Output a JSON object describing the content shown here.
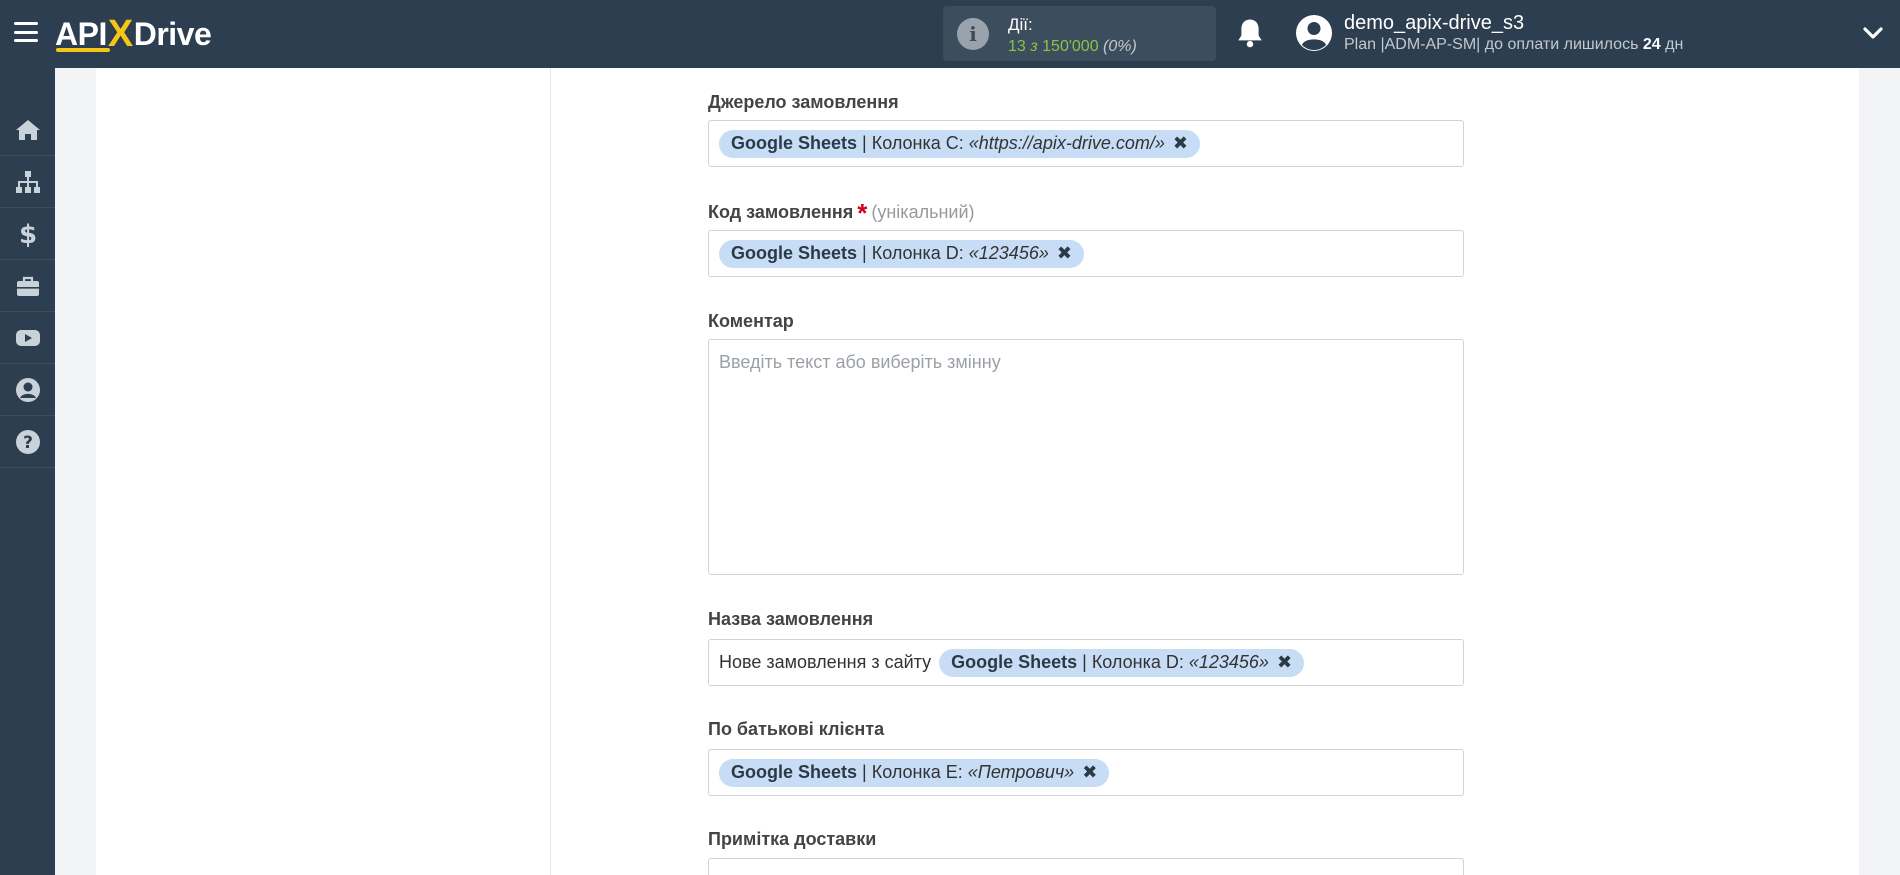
{
  "header": {
    "logo_left": "API",
    "logo_x": "X",
    "logo_right": "Drive",
    "actions_label": "Дії:",
    "actions_count": "13",
    "actions_of": "з",
    "actions_total": "150'000",
    "actions_pct": "(0%)",
    "username": "demo_apix-drive_s3",
    "plan_prefix": "Plan |ADM-AP-SM| до оплати лишилось",
    "plan_days": "24",
    "plan_suffix": "дн"
  },
  "sidebar": {
    "items": [
      {
        "icon": "home-icon"
      },
      {
        "icon": "sitemap-icon"
      },
      {
        "icon": "dollar-icon"
      },
      {
        "icon": "briefcase-icon"
      },
      {
        "icon": "youtube-icon"
      },
      {
        "icon": "user-circle-icon"
      },
      {
        "icon": "question-icon"
      }
    ]
  },
  "form": {
    "fields": [
      {
        "label": "Джерело замовлення",
        "chip": {
          "source": "Google Sheets",
          "separator": "|",
          "column": "Колонка C:",
          "value": "«https://apix-drive.com/»"
        }
      },
      {
        "label": "Код замовлення",
        "required": "*",
        "hint": "(унікальний)",
        "chip": {
          "source": "Google Sheets",
          "separator": "|",
          "column": "Колонка D:",
          "value": "«123456»"
        }
      },
      {
        "label": "Коментар",
        "placeholder": "Введіть текст або виберіть змінну"
      },
      {
        "label": "Назва замовлення",
        "prefix_text": "Нове замовлення з сайту",
        "chip": {
          "source": "Google Sheets",
          "separator": "|",
          "column": "Колонка D:",
          "value": "«123456»"
        }
      },
      {
        "label": "По батькові клієнта",
        "chip": {
          "source": "Google Sheets",
          "separator": "|",
          "column": "Колонка E:",
          "value": "«Петрович»"
        }
      },
      {
        "label": "Примітка доставки"
      }
    ],
    "remove_glyph": "✖"
  },
  "colors": {
    "topbar": "#2c3e50",
    "accent": "#f5c518",
    "chip_bg": "#c7ddf5",
    "actions_green": "#8bc34a",
    "required_red": "#d0021b"
  }
}
